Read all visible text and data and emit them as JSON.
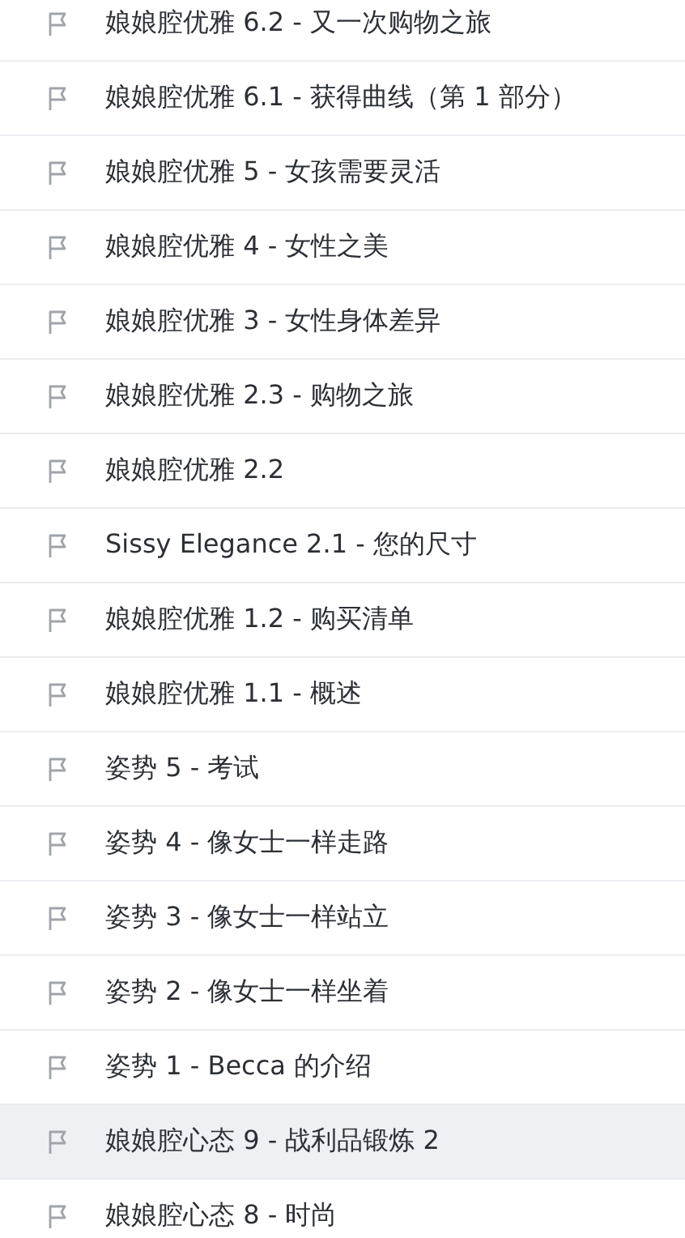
{
  "lessons": [
    {
      "title": "娘娘腔优雅 6.2 - 又一次购物之旅",
      "selected": false
    },
    {
      "title": "娘娘腔优雅 6.1 - 获得曲线（第 1 部分）",
      "selected": false
    },
    {
      "title": "娘娘腔优雅 5 - 女孩需要灵活",
      "selected": false
    },
    {
      "title": "娘娘腔优雅 4 - 女性之美",
      "selected": false
    },
    {
      "title": "娘娘腔优雅 3 - 女性身体差异",
      "selected": false
    },
    {
      "title": "娘娘腔优雅 2.3 - 购物之旅",
      "selected": false
    },
    {
      "title": "娘娘腔优雅 2.2",
      "selected": false
    },
    {
      "title": "Sissy Elegance 2.1 - 您的尺寸",
      "selected": false
    },
    {
      "title": "娘娘腔优雅 1.2 - 购买清单",
      "selected": false
    },
    {
      "title": "娘娘腔优雅 1.1 - 概述",
      "selected": false
    },
    {
      "title": "姿势 5 - 考试",
      "selected": false
    },
    {
      "title": "姿势 4 - 像女士一样走路",
      "selected": false
    },
    {
      "title": "姿势 3 - 像女士一样站立",
      "selected": false
    },
    {
      "title": "姿势 2 - 像女士一样坐着",
      "selected": false
    },
    {
      "title": "姿势 1 - Becca 的介绍",
      "selected": false
    },
    {
      "title": "娘娘腔心态 9 - 战利品锻炼 2",
      "selected": true
    },
    {
      "title": "娘娘腔心态 8 - 时尚",
      "selected": false
    }
  ]
}
